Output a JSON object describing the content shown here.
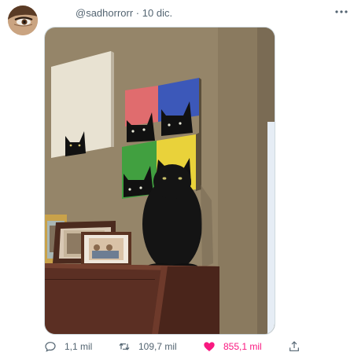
{
  "tweet": {
    "handle": "@sadhorrorr",
    "separator": "·",
    "date": "10 dic.",
    "more_icon": "more-horizontal-icon"
  },
  "actions": {
    "reply_count": "1,1 mil",
    "retweet_count": "109,7 mil",
    "like_count": "855,1 mil",
    "like_color": "#f91880",
    "muted_color": "#536471"
  }
}
